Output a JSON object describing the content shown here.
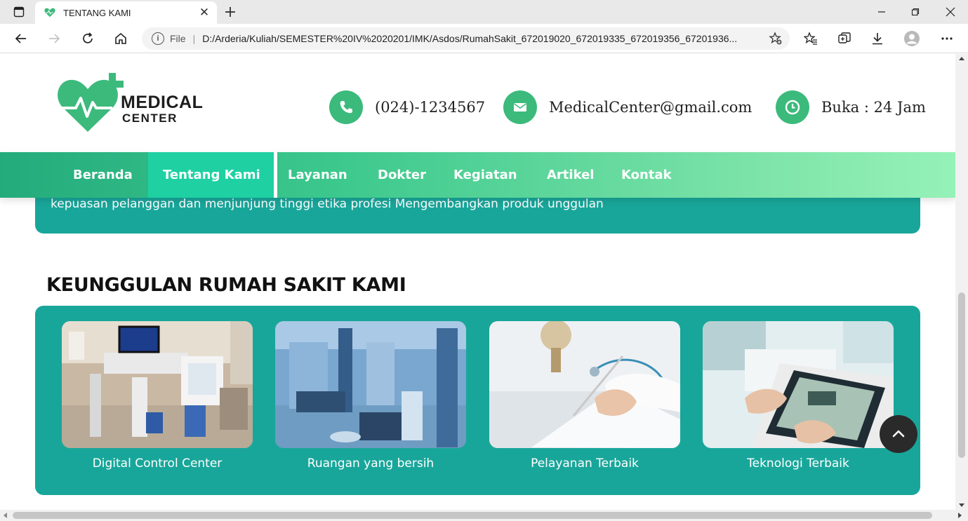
{
  "browser": {
    "tab_title": "TENTANG KAMI",
    "address_scheme_label": "File",
    "address_url": "D:/Arderia/Kuliah/SEMESTER%20IV%2020201/IMK/Asdos/RumahSakit_672019020_672019335_672019356_67201936...",
    "icons": [
      "tab-actions-icon",
      "favicon-heart-icon",
      "close-tab-icon",
      "new-tab-icon",
      "minimize-icon",
      "maximize-icon",
      "close-window-icon",
      "back-icon",
      "forward-icon",
      "reload-icon",
      "home-icon",
      "info-icon",
      "add-favorite-icon",
      "favorites-icon",
      "collections-icon",
      "downloads-icon",
      "profile-icon",
      "more-icon"
    ]
  },
  "brand": {
    "line1": "MEDICAL",
    "line2": "CENTER",
    "colors": {
      "green": "#3cba7c",
      "teal": "#19a69a",
      "nav_active": "#1fd0a3"
    }
  },
  "contact": {
    "phone": "(024)-1234567",
    "email": "MedicalCenter@gmail.com",
    "hours": "Buka : 24 Jam"
  },
  "nav": {
    "items": [
      "Beranda",
      "Tentang Kami",
      "Layanan",
      "Dokter",
      "Kegiatan",
      "Artikel",
      "Kontak"
    ],
    "active": "Tentang Kami"
  },
  "mission": {
    "line": "kepuasan pelanggan dan menjunjung tinggi etika profesi Mengembangkan produk unggulan"
  },
  "advantages": {
    "title": "KEUNGGULAN RUMAH SAKIT KAMI",
    "cards": [
      {
        "caption": "Digital Control Center"
      },
      {
        "caption": "Ruangan yang bersih"
      },
      {
        "caption": "Pelayanan Terbaik"
      },
      {
        "caption": "Teknologi Terbaik"
      }
    ]
  }
}
